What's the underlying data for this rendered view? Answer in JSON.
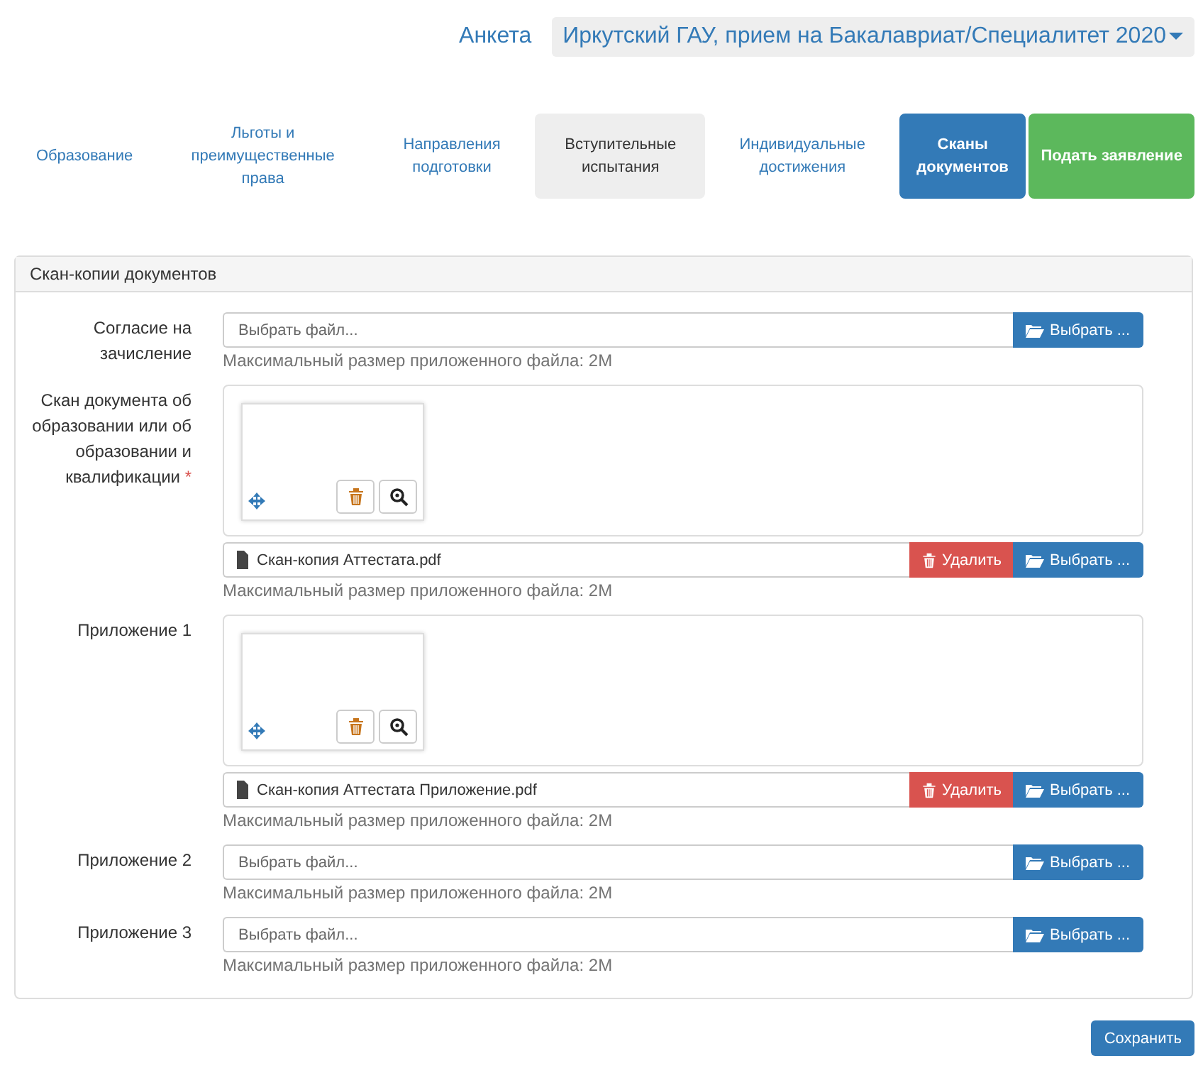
{
  "header": {
    "link": "Анкета",
    "dropdown": "Иркутский ГАУ, прием на Бакалавриат/Специалитет 2020"
  },
  "steps": [
    {
      "kind": "step",
      "label": "Образование",
      "selected": false,
      "shaded": false
    },
    {
      "kind": "step",
      "label": "Льготы и преимущественные права",
      "selected": false,
      "shaded": false
    },
    {
      "kind": "step",
      "label": "Направления подготовки",
      "selected": false,
      "shaded": false
    },
    {
      "kind": "step",
      "label": "Вступительные испытания",
      "selected": false,
      "shaded": true
    },
    {
      "kind": "step",
      "label": "Индивидуальные достижения",
      "selected": false,
      "shaded": false
    },
    {
      "kind": "step",
      "label": "Сканы документов",
      "selected": true,
      "shaded": false
    },
    {
      "kind": "submit",
      "label": "Подать заявление"
    }
  ],
  "panel": {
    "title": "Скан-копии документов",
    "documents": [
      {
        "label": "Согласие на зачисление",
        "placeholder": "Выбрать файл...",
        "browse": "Выбрать ...",
        "hint": "Максимальный размер приложенного файла: 2M"
      },
      {
        "label": "Скан документа об образовании или об образовании и квалификации",
        "required_mark": "*",
        "file": "Скан-копия Аттестата.pdf",
        "remove": "Удалить",
        "browse": "Выбрать ...",
        "hint": "Максимальный размер приложенного файла: 2M"
      },
      {
        "label": "Приложение 1",
        "file": "Скан-копия Аттестата Приложение.pdf",
        "remove": "Удалить",
        "browse": "Выбрать ...",
        "hint": "Максимальный размер приложенного файла: 2M"
      },
      {
        "label": "Приложение 2",
        "placeholder": "Выбрать файл...",
        "browse": "Выбрать ...",
        "hint": "Максимальный размер приложенного файла: 2M"
      },
      {
        "label": "Приложение 3",
        "placeholder": "Выбрать файл...",
        "browse": "Выбрать ...",
        "hint": "Максимальный размер приложенного файла: 2M"
      }
    ]
  },
  "save": "Сохранить"
}
